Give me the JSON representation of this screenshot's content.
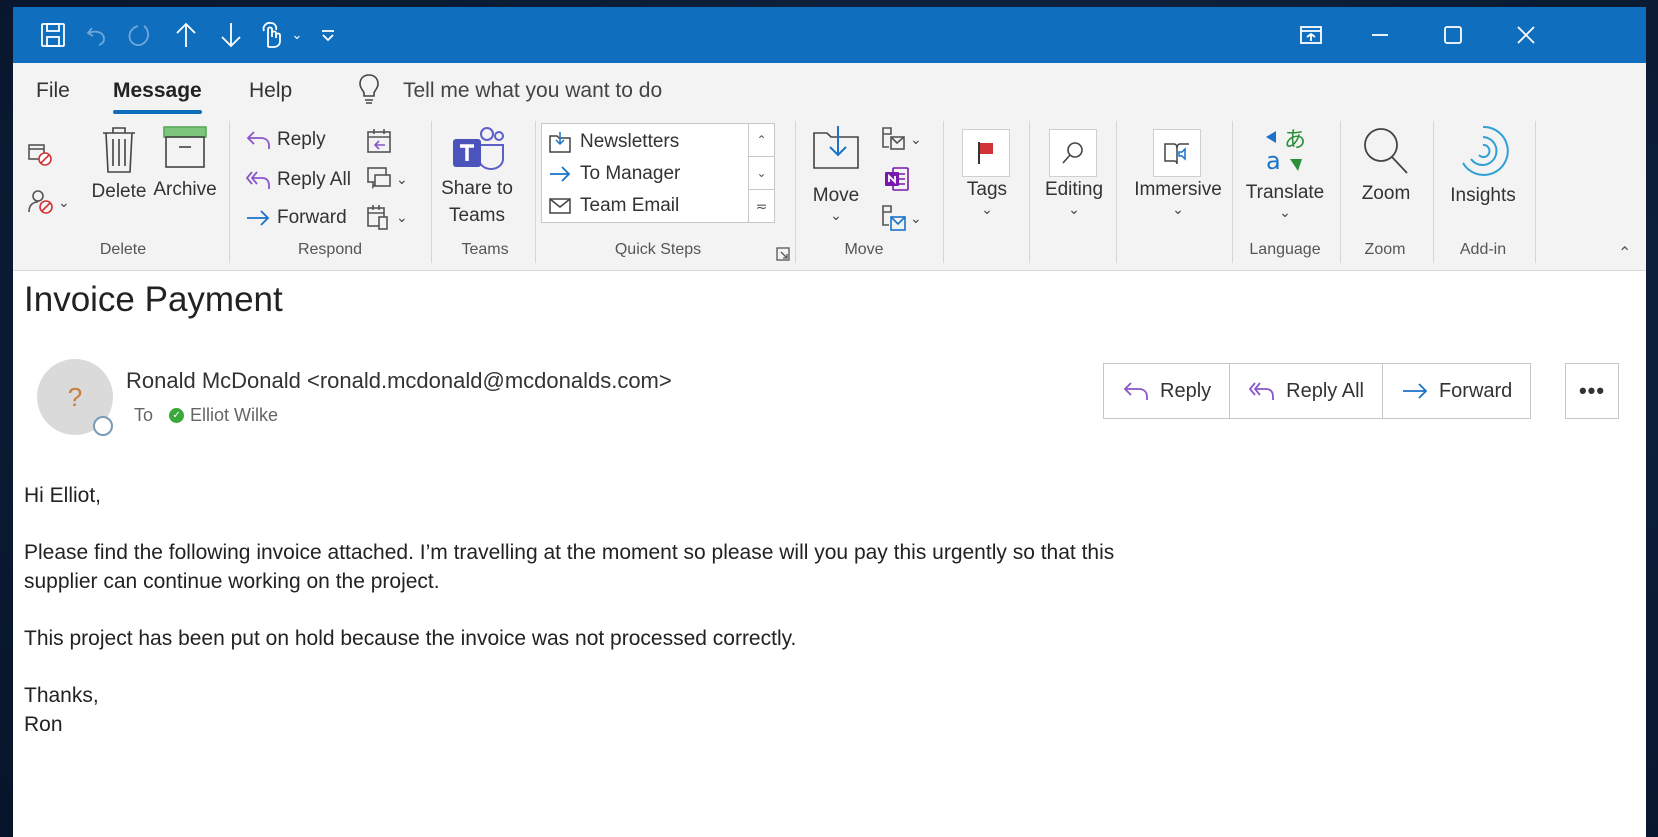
{
  "titlebar": {
    "icons": [
      "save-icon",
      "undo-icon",
      "redo-icon",
      "up-arrow-icon",
      "down-arrow-icon",
      "touch-mode-icon",
      "customize-qat-icon",
      "ribbon-display-options-icon",
      "minimize-icon",
      "maximize-icon",
      "close-icon"
    ]
  },
  "menu": {
    "file": "File",
    "message": "Message",
    "help": "Help",
    "tell_me": "Tell me what you want to do"
  },
  "ribbon": {
    "delete_group": {
      "delete": "Delete",
      "archive": "Archive",
      "label": "Delete"
    },
    "respond_group": {
      "reply": "Reply",
      "reply_all": "Reply All",
      "forward": "Forward",
      "label": "Respond"
    },
    "teams_group": {
      "share_line1": "Share to",
      "share_line2": "Teams",
      "label": "Teams"
    },
    "quick_steps": {
      "items": [
        "Newsletters",
        "To Manager",
        "Team Email"
      ],
      "label": "Quick Steps"
    },
    "move_group": {
      "move": "Move",
      "label": "Move"
    },
    "tags": "Tags",
    "editing": "Editing",
    "immersive": "Immersive",
    "language_group": {
      "translate": "Translate",
      "label": "Language"
    },
    "zoom_group": {
      "zoom": "Zoom",
      "label": "Zoom"
    },
    "addin_group": {
      "insights": "Insights",
      "label": "Add-in"
    }
  },
  "email": {
    "subject": "Invoice Payment",
    "avatar_initial": "?",
    "sender": "Ronald McDonald <ronald.mcdonald@mcdonalds.com>",
    "to_label": "To",
    "recipient": "Elliot Wilke",
    "actions": {
      "reply": "Reply",
      "reply_all": "Reply All",
      "forward": "Forward",
      "more": "•••"
    },
    "body": {
      "greeting": "Hi Elliot,",
      "paragraph1_line1": "Please find the following invoice attached. I’m travelling at the moment so please will you pay this urgently so that this",
      "paragraph1_line2": "supplier can continue working on the project.",
      "paragraph2": "This project has been put on hold because the invoice was not processed correctly.",
      "signoff": "Thanks,",
      "signature": "Ron"
    }
  },
  "colors": {
    "titlebar": "#106ebe",
    "ribbon": "#f3f3f3",
    "accent_purple": "#8a55c9",
    "accent_blue": "#1a73c8",
    "flag_red": "#d13438",
    "presence_green": "#3aa83a"
  }
}
